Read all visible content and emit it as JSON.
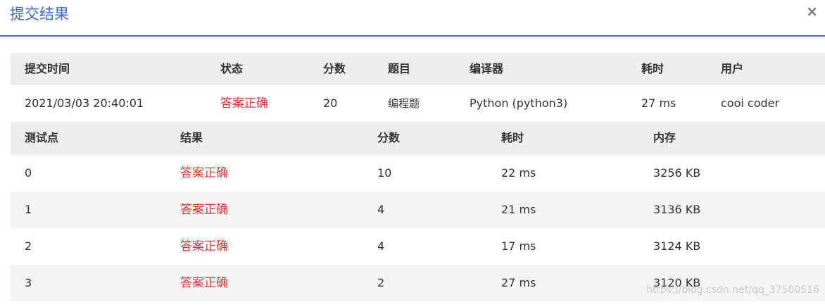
{
  "header": {
    "title": "提交结果",
    "close": "×"
  },
  "summary": {
    "columns": [
      "提交时间",
      "状态",
      "分数",
      "题目",
      "编译器",
      "耗时",
      "用户"
    ],
    "row": {
      "time": "2021/03/03 20:40:01",
      "status": "答案正确",
      "score": "20",
      "problem": "编程题",
      "compiler": "Python (python3)",
      "elapsed": "27 ms",
      "user": "cooi coder"
    }
  },
  "cases": {
    "columns": [
      "测试点",
      "结果",
      "分数",
      "耗时",
      "内存"
    ],
    "rows": [
      {
        "id": "0",
        "result": "答案正确",
        "score": "10",
        "time": "22 ms",
        "memory": "3256 KB"
      },
      {
        "id": "1",
        "result": "答案正确",
        "score": "4",
        "time": "21 ms",
        "memory": "3136 KB"
      },
      {
        "id": "2",
        "result": "答案正确",
        "score": "4",
        "time": "17 ms",
        "memory": "3124 KB"
      },
      {
        "id": "3",
        "result": "答案正确",
        "score": "2",
        "time": "27 ms",
        "memory": "3120 KB"
      }
    ]
  },
  "watermark": "https://blog.csdn.net/qq_37500516"
}
